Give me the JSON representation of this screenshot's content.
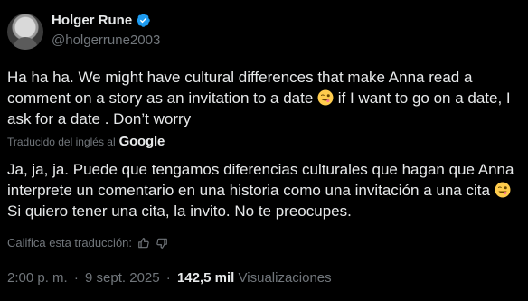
{
  "author": {
    "display_name": "Holger Rune",
    "handle": "@holgerrune2003",
    "verified": true,
    "avatar_icon": "avatar-photo",
    "verified_color": "#1d9bf0"
  },
  "tweet": {
    "text_before_emoji": "Ha ha ha. We might have cultural differences that make Anna read a comment on a story as an invitation to a date ",
    "text_after_emoji": " if I want to go on a date, I ask for a date . Don’t worry",
    "emoji_icon": "winking-face-with-tongue-emoji"
  },
  "translation": {
    "translated_by": "Traducido del inglés al",
    "provider": "Google",
    "text_before_emoji": "Ja, ja, ja. Puede que tengamos diferencias culturales que hagan que Anna interprete un comentario en una historia como una invitación a una cita ",
    "text_after_emoji": " Si quiero tener una cita, la invito. No te preocupes.",
    "rate_label": "Califica esta traducción:",
    "thumb_up_icon": "thumbs-up-icon",
    "thumb_down_icon": "thumbs-down-icon"
  },
  "meta": {
    "time": "2:00 p. m.",
    "separator": "·",
    "date": "9 sept. 2025",
    "views_count": "142,5 mil",
    "views_label": "Visualizaciones"
  },
  "colors": {
    "background": "#000000",
    "text": "#e7e9ea",
    "secondary": "#71767b",
    "accent": "#1d9bf0"
  }
}
